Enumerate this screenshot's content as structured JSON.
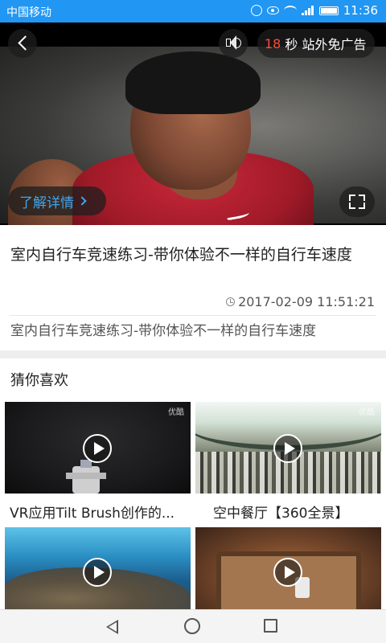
{
  "status_bar": {
    "carrier": "中国移动",
    "network_type": "4G",
    "time": "11:36",
    "icons": [
      "alarm-icon",
      "eye-icon",
      "wifi-icon",
      "signal-icon",
      "battery-icon"
    ]
  },
  "video_player": {
    "ad_countdown": "18",
    "ad_skip_label": "秒 站外免广告",
    "detail_link": "了解详情",
    "icons": [
      "back-icon",
      "volume-icon",
      "fullscreen-icon"
    ],
    "accent_color": "#ff4b3a",
    "link_color": "#3ea6f0"
  },
  "article": {
    "title": "室内自行车竞速练习-带你体验不一样的自行车速度",
    "date": "2017-02-09 11:51:21",
    "description": "室内自行车竞速练习-带你体验不一样的自行车速度"
  },
  "recommend": {
    "section_title": "猜你喜欢",
    "items": [
      {
        "label": "VR应用Tilt Brush创作的...",
        "watermark": "优酷"
      },
      {
        "label": "空中餐厅【360全景】",
        "watermark": "优酷"
      },
      {
        "label": "",
        "watermark": ""
      },
      {
        "label": "",
        "watermark": ""
      }
    ]
  },
  "theme": {
    "status_bar_color": "#2196f3"
  }
}
